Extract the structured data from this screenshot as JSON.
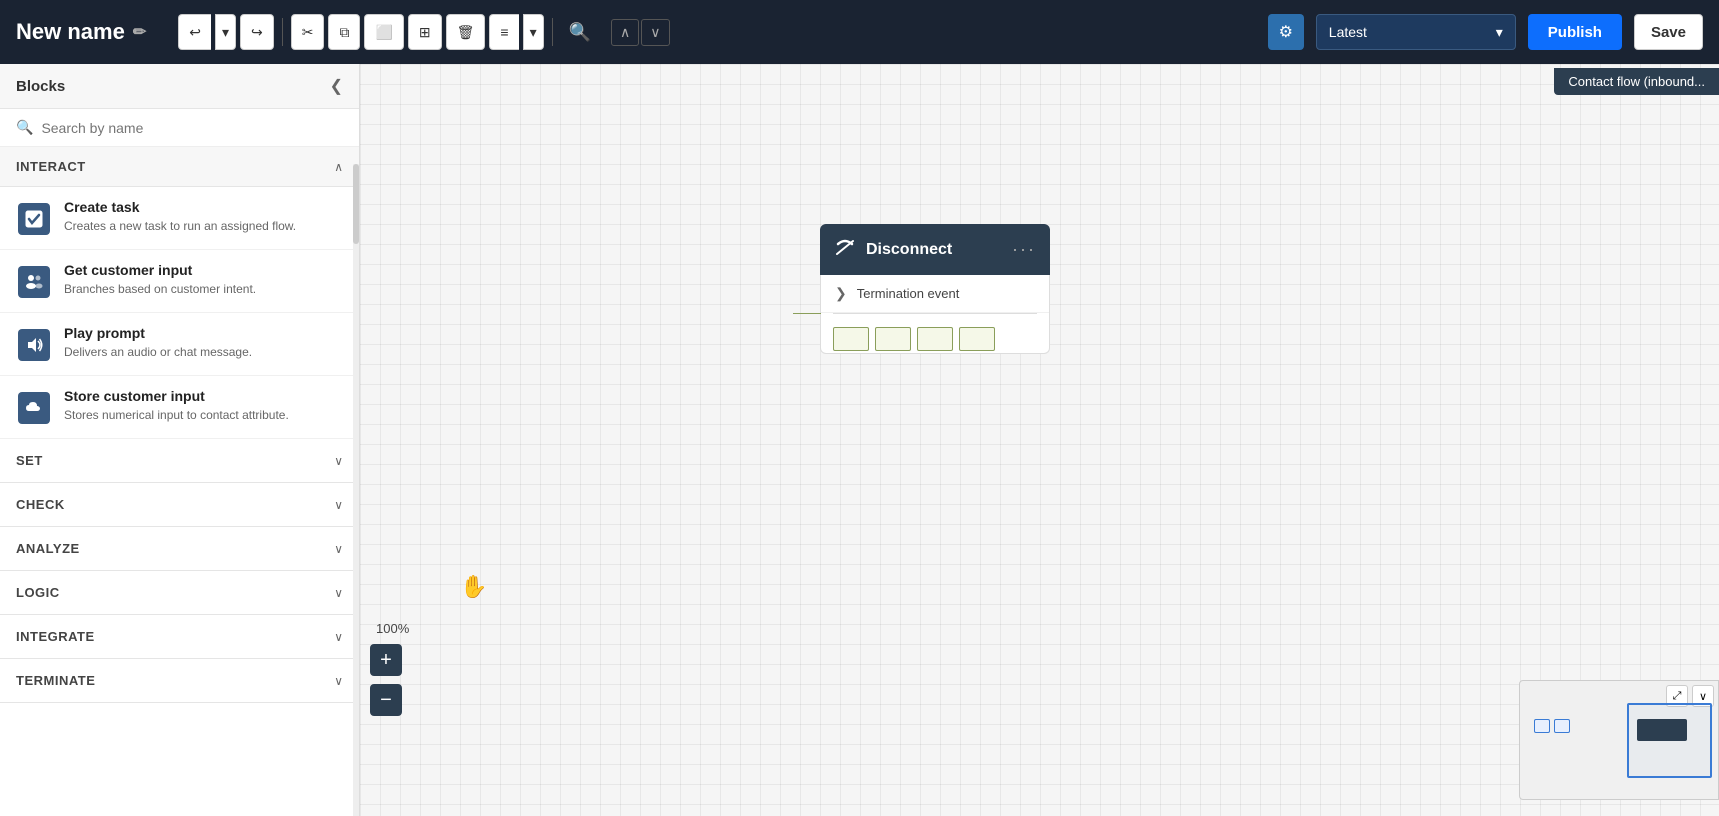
{
  "header": {
    "title": "New name",
    "edit_icon": "✏",
    "toolbar": {
      "undo": "↩",
      "undo_dropdown": "▾",
      "redo": "↪",
      "cut": "✂",
      "copy": "⧉",
      "crop": "⬜",
      "grid": "⊞",
      "delete": "🗑",
      "layout": "≡",
      "layout_dropdown": "▾",
      "search": "🔍",
      "nav_up": "∧",
      "nav_down": "∨"
    },
    "settings_icon": "⚙",
    "version": "Latest",
    "publish_label": "Publish",
    "save_label": "Save",
    "contact_flow_badge": "Contact flow (inbound..."
  },
  "sidebar": {
    "title": "Blocks",
    "collapse_icon": "❮",
    "search_placeholder": "Search by name",
    "sections": {
      "interact": {
        "label": "INTERACT",
        "expanded": true,
        "blocks": [
          {
            "name": "Create task",
            "desc": "Creates a new task to run an assigned flow.",
            "icon": "✔"
          },
          {
            "name": "Get customer input",
            "desc": "Branches based on customer intent.",
            "icon": "👥"
          },
          {
            "name": "Play prompt",
            "desc": "Delivers an audio or chat message.",
            "icon": "🔊"
          },
          {
            "name": "Store customer input",
            "desc": "Stores numerical input to contact attribute.",
            "icon": "☁"
          }
        ]
      },
      "set": {
        "label": "SET",
        "expanded": false
      },
      "check": {
        "label": "CHECK",
        "expanded": false
      },
      "analyze": {
        "label": "ANALYZE",
        "expanded": false
      },
      "logic": {
        "label": "LOGIC",
        "expanded": false
      },
      "integrate": {
        "label": "INTEGRATE",
        "expanded": false
      },
      "terminate": {
        "label": "TERMINATE",
        "expanded": false
      }
    }
  },
  "canvas": {
    "zoom": "100%",
    "zoom_plus": "+",
    "zoom_minus": "−",
    "node": {
      "title": "Disconnect",
      "menu": "···",
      "termination_label": "Termination event"
    }
  }
}
